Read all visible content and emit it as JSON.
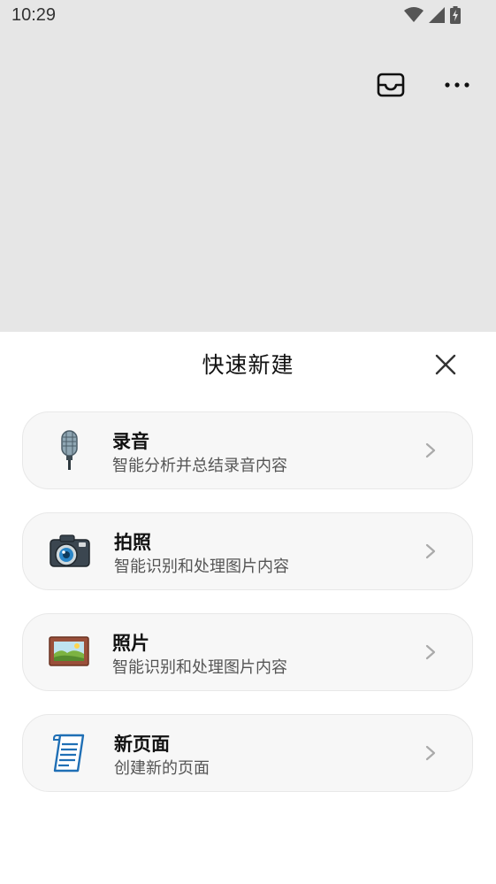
{
  "status_bar": {
    "time": "10:29",
    "icons": [
      "wifi-icon",
      "signal-icon",
      "battery-charging-icon"
    ]
  },
  "top_actions": {
    "inbox_icon": "inbox-icon",
    "more_icon": "more-horizontal-icon"
  },
  "sheet": {
    "title": "快速新建",
    "close_icon": "close-icon",
    "items": [
      {
        "title": "录音",
        "description": "智能分析并总结录音内容",
        "icon": "microphone-icon"
      },
      {
        "title": "拍照",
        "description": "智能识别和处理图片内容",
        "icon": "camera-icon"
      },
      {
        "title": "照片",
        "description": "智能识别和处理图片内容",
        "icon": "picture-frame-icon"
      },
      {
        "title": "新页面",
        "description": "创建新的页面",
        "icon": "document-icon"
      }
    ]
  },
  "colors": {
    "dim_background": "#e6e6e6",
    "card_background": "#f7f7f7",
    "card_border": "#e8e8e8",
    "doc_icon_blue": "#1f6fb5"
  }
}
